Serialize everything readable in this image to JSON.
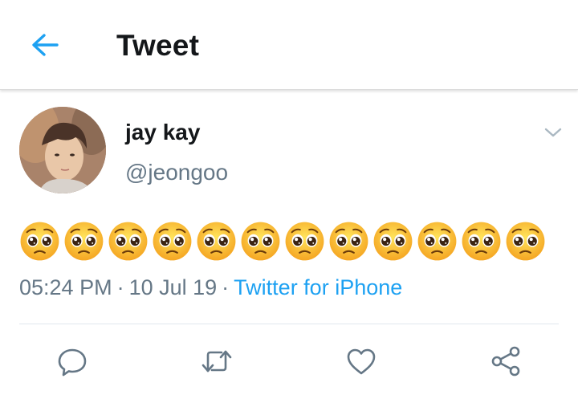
{
  "header": {
    "title": "Tweet",
    "back_icon": "arrow-left-icon"
  },
  "tweet": {
    "author": {
      "display_name": "jay kay",
      "handle": "@jeongoo"
    },
    "text": "🥺🥺🥺🥺🥺🥺🥺🥺🥺🥺🥺🥺",
    "emoji_count": 12,
    "time": "05:24 PM",
    "date": "10 Jul 19",
    "source": "Twitter for iPhone"
  },
  "actions": [
    "reply-icon",
    "retweet-icon",
    "like-icon",
    "share-icon"
  ],
  "colors": {
    "accent": "#1da1f2",
    "secondary_text": "#657786",
    "primary_text": "#14171a",
    "divider": "#e1e8ed"
  }
}
